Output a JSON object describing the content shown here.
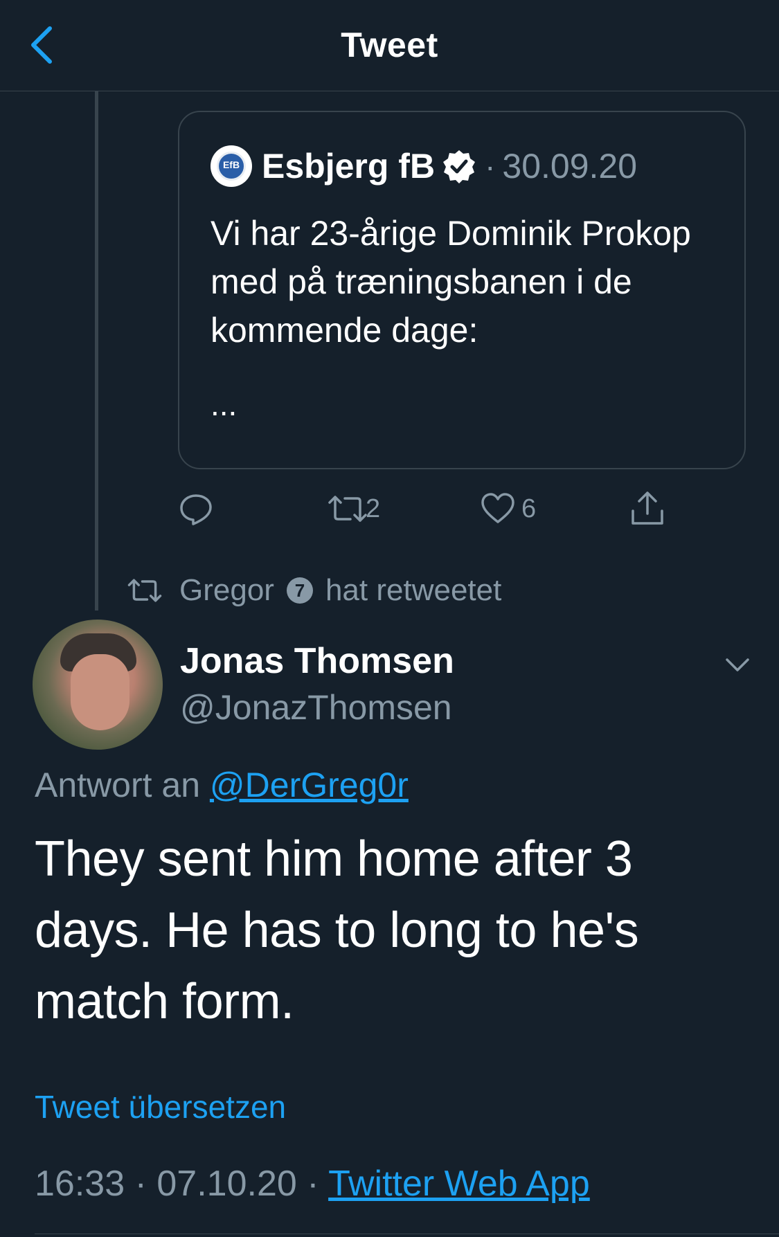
{
  "header": {
    "title": "Tweet",
    "back_icon": "chevron-left-icon"
  },
  "quoted_tweet": {
    "name": "Esbjerg fB",
    "logo_text": "EfB",
    "separator": "·",
    "date": "30.09.20",
    "text": "Vi har 23-årige Dominik Prokop med på træningsbanen i de kommende dage:",
    "ellipsis": "...",
    "reply_count": "",
    "retweet_count": "2",
    "like_count": "6"
  },
  "retweet_info": {
    "user": "Gregor",
    "badge": "7",
    "label": "hat retweetet"
  },
  "tweet": {
    "author_name": "Jonas Thomsen",
    "author_handle": "@JonazThomsen",
    "reply_prefix": "Antwort an",
    "reply_handle": "@DerGreg0r",
    "text": "They sent him home after 3 days. He has to long to he's match form.",
    "translate_label": "Tweet übersetzen",
    "time": "16:33",
    "sep1": "·",
    "date": "07.10.20",
    "sep2": "·",
    "source": "Twitter Web App"
  },
  "colors": {
    "background": "#15202b",
    "border": "#38444d",
    "muted": "#8899a6",
    "accent": "#1da1f2",
    "text": "#ffffff"
  }
}
